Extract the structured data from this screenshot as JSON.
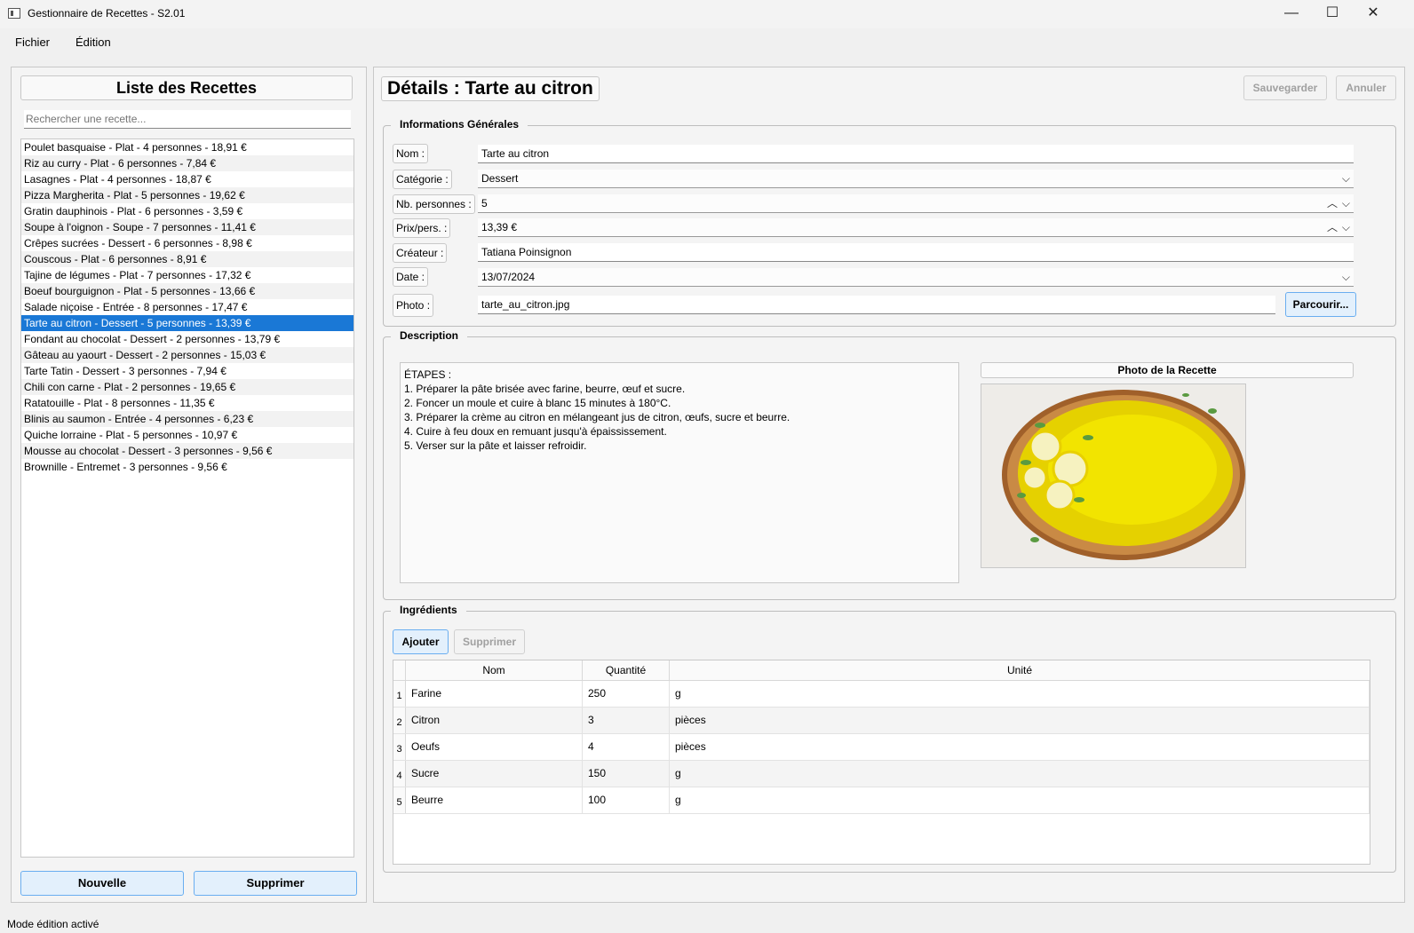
{
  "window": {
    "title": "Gestionnaire de Recettes - S2.01",
    "minimize": "—",
    "maximize": "☐",
    "close": "✕"
  },
  "menu": [
    "Fichier",
    "Édition"
  ],
  "left": {
    "title": "Liste des Recettes",
    "search_placeholder": "Rechercher une recette...",
    "recipes": [
      "Poulet basquaise - Plat - 4 personnes - 18,91 €",
      "Riz au curry - Plat - 6 personnes - 7,84 €",
      "Lasagnes - Plat - 4 personnes - 18,87 €",
      "Pizza Margherita - Plat - 5 personnes - 19,62 €",
      "Gratin dauphinois - Plat - 6 personnes - 3,59 €",
      "Soupe à l'oignon - Soupe - 7 personnes - 11,41 €",
      "Crêpes sucrées - Dessert - 6 personnes - 8,98 €",
      "Couscous - Plat - 6 personnes - 8,91 €",
      "Tajine de légumes - Plat - 7 personnes - 17,32 €",
      "Boeuf bourguignon - Plat - 5 personnes - 13,66 €",
      "Salade niçoise - Entrée - 8 personnes - 17,47 €",
      "Tarte au citron - Dessert - 5 personnes - 13,39 €",
      "Fondant au chocolat - Dessert - 2 personnes - 13,79 €",
      "Gâteau au yaourt - Dessert - 2 personnes - 15,03 €",
      "Tarte Tatin - Dessert - 3 personnes - 7,94 €",
      "Chili con carne - Plat - 2 personnes - 19,65 €",
      "Ratatouille - Plat - 8 personnes - 11,35 €",
      "Blinis au saumon - Entrée - 4 personnes - 6,23 €",
      "Quiche lorraine - Plat - 5 personnes - 10,97 €",
      "Mousse au chocolat - Dessert - 3 personnes - 9,56 €",
      "Brownille - Entremet - 3 personnes - 9,56 €"
    ],
    "selected_index": 11,
    "new_button": "Nouvelle",
    "delete_button": "Supprimer"
  },
  "details": {
    "title": "Détails : Tarte au citron",
    "save_button": "Sauvegarder",
    "cancel_button": "Annuler",
    "general": {
      "title": "Informations Générales",
      "nom_label": "Nom :",
      "nom": "Tarte au citron",
      "categorie_label": "Catégorie :",
      "categorie": "Dessert",
      "personnes_label": "Nb. personnes :",
      "personnes": "5",
      "prix_label": "Prix/pers. :",
      "prix": "13,39 €",
      "createur_label": "Créateur :",
      "createur": "Tatiana Poinsignon",
      "date_label": "Date :",
      "date": "13/07/2024",
      "photo_label": "Photo :",
      "photo": "tarte_au_citron.jpg",
      "browse_button": "Parcourir..."
    },
    "description": {
      "title": "Description",
      "lines": [
        "ÉTAPES :",
        "1. Préparer la pâte brisée avec farine, beurre, œuf et sucre.",
        "2. Foncer un moule et cuire à blanc 15 minutes à 180°C.",
        "3. Préparer la crème au citron en mélangeant jus de citron, œufs, sucre et beurre.",
        "4. Cuire à feu doux en remuant jusqu'à épaississement.",
        "5. Verser sur la pâte et laisser refroidir."
      ],
      "photo_title": "Photo de la Recette"
    },
    "ingredients": {
      "title": "Ingrédients",
      "add_button": "Ajouter",
      "delete_button": "Supprimer",
      "columns": [
        "Nom",
        "Quantité",
        "Unité"
      ],
      "rows": [
        {
          "num": "1",
          "nom": "Farine",
          "quantite": "250",
          "unite": "g"
        },
        {
          "num": "2",
          "nom": "Citron",
          "quantite": "3",
          "unite": "pièces"
        },
        {
          "num": "3",
          "nom": "Oeufs",
          "quantite": "4",
          "unite": "pièces"
        },
        {
          "num": "4",
          "nom": "Sucre",
          "quantite": "150",
          "unite": "g"
        },
        {
          "num": "5",
          "nom": "Beurre",
          "quantite": "100",
          "unite": "g"
        }
      ]
    }
  },
  "status": "Mode édition activé",
  "colors": {
    "selection": "#1a78d6",
    "accent_button": "#e3f0fc"
  }
}
